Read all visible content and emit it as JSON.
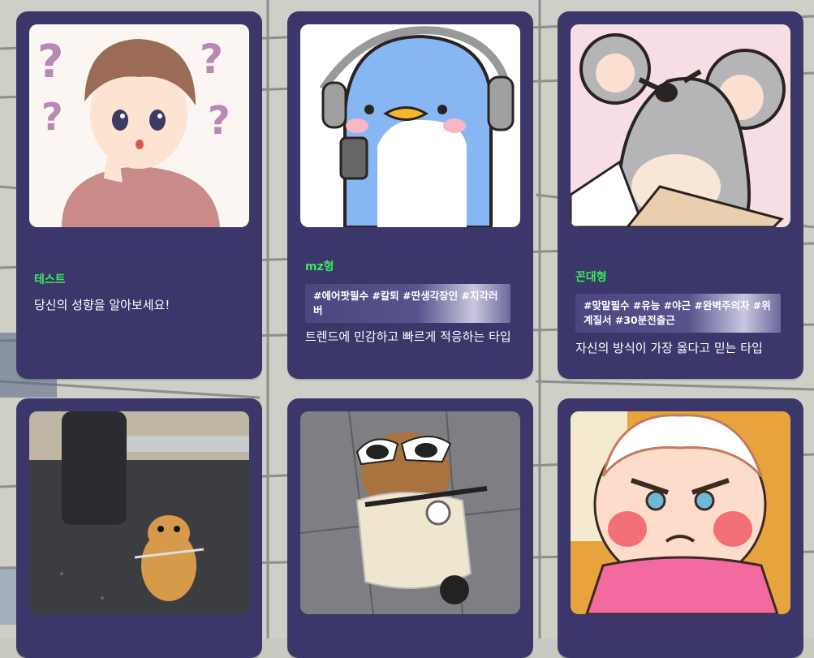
{
  "cards": [
    {
      "title": "테스트",
      "tags": "",
      "description": "당신의 성향을 알아보세요!"
    },
    {
      "title": "mz형",
      "tags": "#에어팟필수 #칼퇴 #딴생각장인 #지각러버",
      "description": "트렌드에 민감하고 빠르게 적응하는 타입"
    },
    {
      "title": "꼰대형",
      "tags": "#맞말필수 #유능 #야근 #완벽주의자 #위계질서 #30분전출근",
      "description": "자신의 방식이 가장 옳다고 믿는 타입"
    },
    {
      "title": "",
      "tags": "",
      "description": ""
    },
    {
      "title": "",
      "tags": "",
      "description": ""
    },
    {
      "title": "",
      "tags": "",
      "description": ""
    }
  ]
}
